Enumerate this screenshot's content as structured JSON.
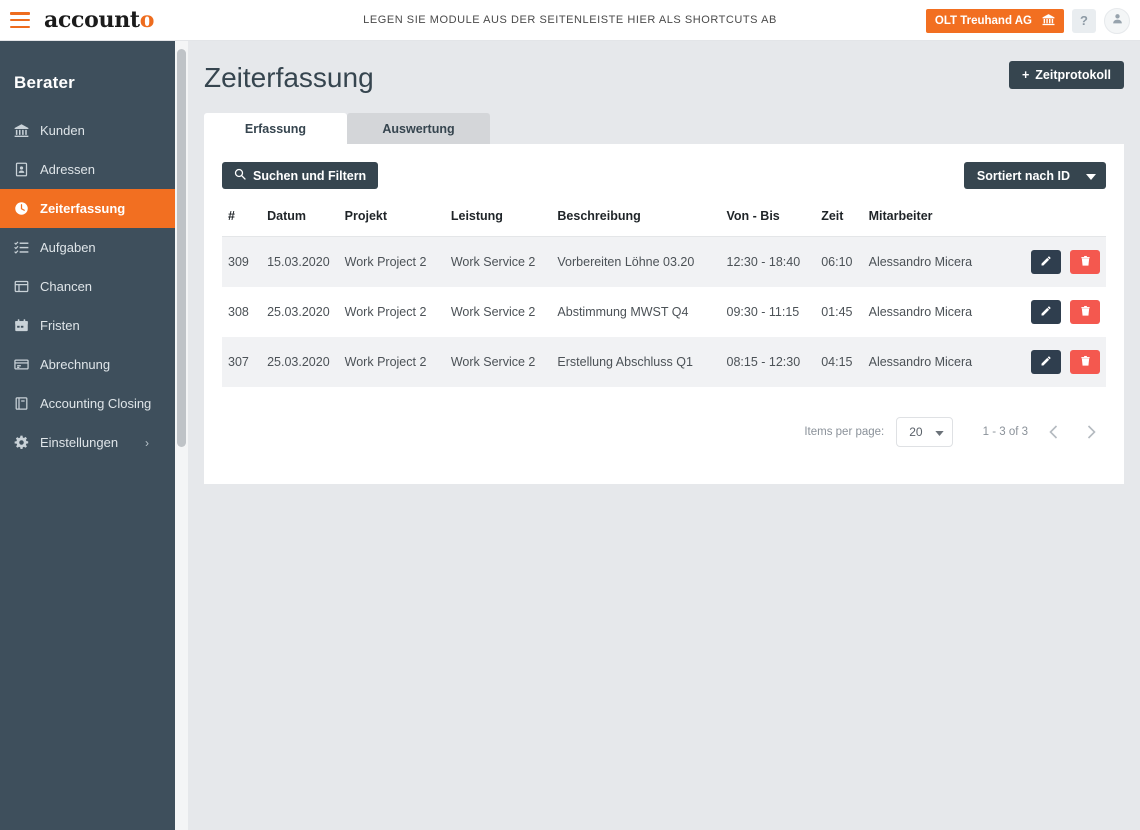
{
  "topbar": {
    "menu_icon": "hamburger-icon",
    "logo_main": "account",
    "logo_accent": "o",
    "tagline": "LEGEN SIE MODULE AUS DER SEITENLEISTE HIER ALS SHORTCUTS AB",
    "tenant_label": "OLT Treuhand AG",
    "tenant_icon": "bank-icon",
    "help_label": "?",
    "avatar_icon": "user-icon",
    "accent_color": "#f26f21"
  },
  "sidebar": {
    "title": "Berater",
    "active_color": "#f26f21",
    "background": "#3e4f5c",
    "items": [
      {
        "label": "Kunden",
        "icon": "bank-icon",
        "active": false
      },
      {
        "label": "Adressen",
        "icon": "contact-card-icon",
        "active": false
      },
      {
        "label": "Zeiterfassung",
        "icon": "clock-icon",
        "active": true
      },
      {
        "label": "Aufgaben",
        "icon": "task-list-icon",
        "active": false
      },
      {
        "label": "Chancen",
        "icon": "board-icon",
        "active": false
      },
      {
        "label": "Fristen",
        "icon": "calendar-icon",
        "active": false
      },
      {
        "label": "Abrechnung",
        "icon": "invoice-card-icon",
        "active": false
      },
      {
        "label": "Accounting Closing",
        "icon": "book-icon",
        "active": false
      },
      {
        "label": "Einstellungen",
        "icon": "gear-icon",
        "active": false,
        "chevron": "›"
      }
    ]
  },
  "page": {
    "title": "Zeiterfassung",
    "add_button": "Zeitprotokoll",
    "add_button_prefix": "+"
  },
  "tabs": [
    {
      "label": "Erfassung",
      "active": true
    },
    {
      "label": "Auswertung",
      "active": false
    }
  ],
  "toolbar": {
    "filter_label": "Suchen und Filtern",
    "filter_icon": "search-icon",
    "sort_label": "Sortiert nach ID",
    "sort_icon": "chevron-down-icon"
  },
  "table": {
    "columns": [
      "#",
      "Datum",
      "Projekt",
      "Leistung",
      "Beschreibung",
      "Von - Bis",
      "Zeit",
      "Mitarbeiter"
    ],
    "row_actions": {
      "edit_icon": "pencil-icon",
      "delete_icon": "trash-icon",
      "edit_color": "#2f3e4e",
      "delete_color": "#f4584f"
    },
    "rows": [
      {
        "id": "309",
        "datum": "15.03.2020",
        "projekt": "Work Project 2",
        "leistung": "Work Service 2",
        "beschreibung": "Vorbereiten Löhne 03.20",
        "von_bis": "12:30 - 18:40",
        "zeit": "06:10",
        "mitarbeiter": "Alessandro Micera"
      },
      {
        "id": "308",
        "datum": "25.03.2020",
        "projekt": "Work Project 2",
        "leistung": "Work Service 2",
        "beschreibung": "Abstimmung MWST Q4",
        "von_bis": "09:30 - 11:15",
        "zeit": "01:45",
        "mitarbeiter": "Alessandro Micera"
      },
      {
        "id": "307",
        "datum": "25.03.2020",
        "projekt": "Work Project 2",
        "leistung": "Work Service 2",
        "beschreibung": "Erstellung Abschluss Q1",
        "von_bis": "08:15 - 12:30",
        "zeit": "04:15",
        "mitarbeiter": "Alessandro Micera"
      }
    ]
  },
  "paginator": {
    "items_per_page_label": "Items per page:",
    "items_per_page_value": "20",
    "range_label": "1 - 3 of 3",
    "prev_icon": "chevron-left-icon",
    "next_icon": "chevron-right-icon"
  }
}
